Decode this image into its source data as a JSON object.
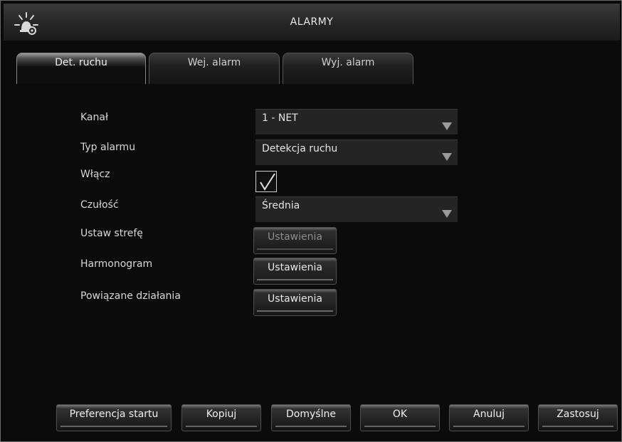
{
  "window": {
    "title": "ALARMY",
    "icon": "alarm-settings-icon"
  },
  "tabs": [
    {
      "label": "Det. ruchu",
      "active": true
    },
    {
      "label": "Wej. alarm",
      "active": false
    },
    {
      "label": "Wyj. alarm",
      "active": false
    }
  ],
  "form": {
    "channel": {
      "label": "Kanał",
      "value": "1 - NET"
    },
    "alarm_type": {
      "label": "Typ alarmu",
      "value": "Detekcja ruchu"
    },
    "enable": {
      "label": "Włącz",
      "checked": true
    },
    "sensitivity": {
      "label": "Czułość",
      "value": "Średnia"
    },
    "zone": {
      "label": "Ustaw strefę",
      "button": "Ustawienia",
      "enabled": false
    },
    "schedule": {
      "label": "Harmonogram",
      "button": "Ustawienia",
      "enabled": true
    },
    "actions": {
      "label": "Powiązane działania",
      "button": "Ustawienia",
      "enabled": true
    }
  },
  "footer": {
    "startup_pref": "Preferencja startu",
    "copy": "Kopiuj",
    "defaults": "Domyślne",
    "ok": "OK",
    "cancel": "Anuluj",
    "apply": "Zastosuj"
  }
}
